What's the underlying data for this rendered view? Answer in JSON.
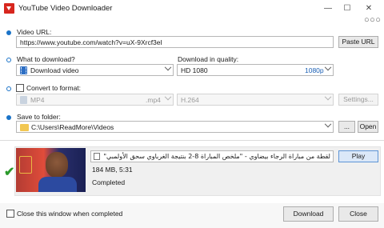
{
  "window": {
    "title": "YouTube Video Downloader",
    "minimize_glyph": "—",
    "maximize_glyph": "☐",
    "close_glyph": "✕",
    "more_glyph": "○○○"
  },
  "url_section": {
    "label": "Video URL:",
    "value": "https://www.youtube.com/watch?v=uX-9Xrcf3eI",
    "paste_button": "Paste URL"
  },
  "what_section": {
    "label": "What to download?",
    "selected": "Download video"
  },
  "quality_section": {
    "label": "Download in quality:",
    "selected": "HD 1080",
    "badge": "1080p"
  },
  "convert_section": {
    "label": "Convert to format:",
    "format": "MP4",
    "format_ext": ".mp4",
    "codec": "H.264",
    "settings_button": "Settings..."
  },
  "folder_section": {
    "label": "Save to folder:",
    "path": "C:\\Users\\ReadMore\\Videos",
    "browse_button": "...",
    "open_button": "Open"
  },
  "result": {
    "video_title": "لقطة من مباراة الرجاء بيضاوي - \"ملخص المباراة 8-2 بنتيجة الغرباوي سحق الأولمبي\"",
    "size_duration": "184 MB, 5:31",
    "status": "Completed",
    "play_button": "Play",
    "check_glyph": "✔"
  },
  "bottom": {
    "close_when_completed_label": "Close this window when completed",
    "download_button": "Download",
    "close_button": "Close"
  },
  "colors": {
    "accent": "#1a73c8",
    "quality_badge": "#1a5fb4",
    "success": "#2b9a2b",
    "brand_red": "#d7261e"
  }
}
